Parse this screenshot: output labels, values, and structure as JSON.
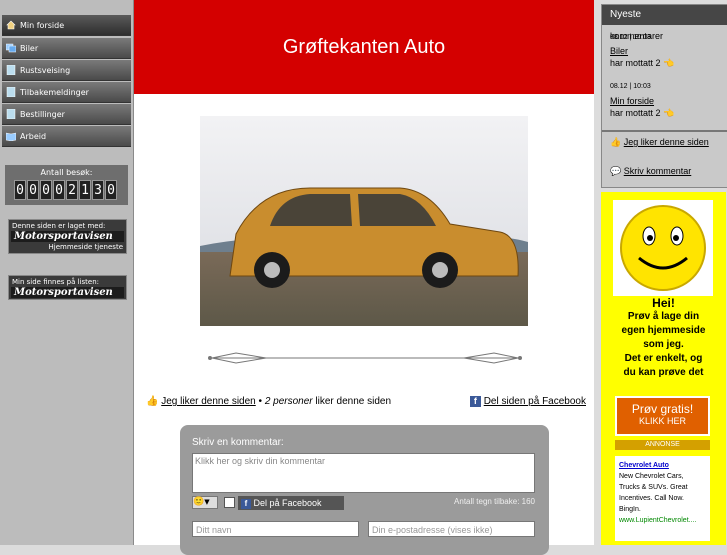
{
  "nav": [
    {
      "label": "Min forside",
      "icon": "home-icon",
      "active": true
    },
    {
      "label": "Biler",
      "icon": "gallery-icon"
    },
    {
      "label": "Rustsveising",
      "icon": "page-icon"
    },
    {
      "label": "Tilbakemeldinger",
      "icon": "page-icon"
    },
    {
      "label": "Bestillinger",
      "icon": "page-icon"
    },
    {
      "label": "Arbeid",
      "icon": "book-icon"
    }
  ],
  "counter": {
    "label": "Antall besøk:",
    "digits": [
      "0",
      "0",
      "0",
      "0",
      "2",
      "1",
      "3",
      "0"
    ]
  },
  "badge1": {
    "line1": "Denne siden er laget med:",
    "line2": "Motorsportavisen",
    "line3": "Hjemmeside tjeneste"
  },
  "badge2": {
    "line1": "Min side finnes på listen:",
    "line2": "Motorsportavisen"
  },
  "header": {
    "title": "Grøftekanten Auto",
    "background": "#d40000"
  },
  "like": {
    "link": "Jeg liker denne siden",
    "sep": " • ",
    "count": "2 personer",
    "suffix": " liker denne siden",
    "share": "Del siden på Facebook"
  },
  "comment": {
    "title": "Skriv en kommentar:",
    "placeholder": "Klikk her og skriv din kommentar",
    "share": "Del på Facebook",
    "count": "Antall tegn tilbake: 160",
    "name_placeholder": "Ditt navn",
    "email_placeholder": "Din e-postadresse (vises ikke)"
  },
  "right": {
    "head": "Nyeste",
    "subhead": "kommentarer",
    "items": [
      {
        "date": "08.12 | 10:03",
        "link": "Biler",
        "text": "har mottatt 2"
      },
      {
        "date": "08.12 | 10:03",
        "link": "Min forside",
        "text": "har mottatt 2"
      }
    ],
    "like_link": "Jeg liker denne siden",
    "comment_link": "Skriv kommentar"
  },
  "ad": {
    "text": [
      "Hei!",
      "Prøv å lage din",
      "egen hjemmeside",
      "som jeg.",
      "Det er enkelt, og",
      "du kan prøve det"
    ],
    "btn1": "Prøv gratis!",
    "btn2": "KLIKK HER",
    "annonse": "ANNONSE",
    "box_title": "Chevrolet Auto",
    "box_text": "New Chevrolet Cars, Trucks & SUVs. Great Incentives. Call Now. BingIn.",
    "box_url": "www.LupientChevrolet...."
  }
}
